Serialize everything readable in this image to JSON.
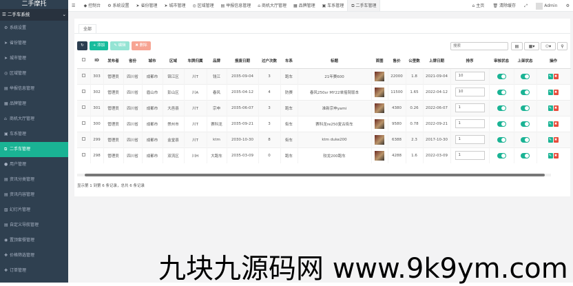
{
  "brand": "二手摩托",
  "sidebar": {
    "section_label": "二手车系统",
    "items": [
      {
        "icon": "⚙",
        "label": "系统设置",
        "active": false
      },
      {
        "icon": "➤",
        "label": "省份管理",
        "active": false
      },
      {
        "icon": "➤",
        "label": "城市管理",
        "active": false
      },
      {
        "icon": "◎",
        "label": "区域管理",
        "active": false
      },
      {
        "icon": "▤",
        "label": "举报信息管理",
        "active": false
      },
      {
        "icon": "▦",
        "label": "品牌管理",
        "active": false
      },
      {
        "icon": "⌂",
        "label": "商机大厅管理",
        "active": false
      },
      {
        "icon": "▣",
        "label": "车系管理",
        "active": false
      },
      {
        "icon": "⧉",
        "label": "二手车管理",
        "active": true
      },
      {
        "icon": "●",
        "label": "用户管理",
        "active": false
      },
      {
        "icon": "▤",
        "label": "资讯分类管理",
        "active": false
      },
      {
        "icon": "▤",
        "label": "资讯内容管理",
        "active": false
      },
      {
        "icon": "▧",
        "label": "幻灯片管理",
        "active": false
      },
      {
        "icon": "▤",
        "label": "自定义导航管理",
        "active": false
      },
      {
        "icon": "◉",
        "label": "置顶套餐管理",
        "active": false
      },
      {
        "icon": "✚",
        "label": "价格筛选管理",
        "active": false
      },
      {
        "icon": "✚",
        "label": "订单管理",
        "active": false
      }
    ]
  },
  "topbar": {
    "tabs": [
      {
        "icon": "◆",
        "label": "控制台",
        "active": false
      },
      {
        "icon": "⚙",
        "label": "系统设置",
        "active": false
      },
      {
        "icon": "➤",
        "label": "省份管理",
        "active": false
      },
      {
        "icon": "➤",
        "label": "城市管理",
        "active": false
      },
      {
        "icon": "◎",
        "label": "区域管理",
        "active": false
      },
      {
        "icon": "▤",
        "label": "举报信息管理",
        "active": false
      },
      {
        "icon": "⌂",
        "label": "商机大厅管理",
        "active": false
      },
      {
        "icon": "▦",
        "label": "品牌管理",
        "active": false
      },
      {
        "icon": "▣",
        "label": "车系管理",
        "active": false
      },
      {
        "icon": "⧉",
        "label": "二手车管理",
        "active": true
      }
    ],
    "home": "主页",
    "clear_cache": "清除缓存",
    "admin": "Admin"
  },
  "tab_all": "全部",
  "toolbar": {
    "refresh": "↻",
    "add": "+ 添加",
    "edit": "✎ 编辑",
    "delete": "✖ 删除",
    "search_placeholder": "搜索",
    "tool1": "▤",
    "tool2": "▦▾",
    "tool3": "⚇▾",
    "tool4": "⚲"
  },
  "colors": {
    "sidebar": "#2f4050",
    "accent": "#1ab394",
    "add": "#18bc9c",
    "edit": "#95e4d4",
    "delete": "#f7a493",
    "refresh": "#2c3e50",
    "op_edit": "#1ab394",
    "op_delete": "#e74c3c"
  },
  "table": {
    "columns": [
      "",
      "ID",
      "发布者",
      "省份",
      "城市",
      "区域",
      "车牌归属",
      "品牌",
      "报废日期",
      "过户次数",
      "车系",
      "标题",
      "首图",
      "售价",
      "公里数",
      "上牌日期",
      "排序",
      "审核状态",
      "上架状态",
      "操作"
    ],
    "rows": [
      [
        "303",
        "管理员",
        "四川省",
        "成都市",
        "锦江区",
        "川T",
        "钱江",
        "2035-09-04",
        "3",
        "跑车",
        "21年赛600",
        "",
        "22000",
        "1.8",
        "2021-09-04",
        "10",
        "",
        "",
        ""
      ],
      [
        "302",
        "管理员",
        "四川省",
        "眉山市",
        "彭山区",
        "川A",
        "春风",
        "2035-04-12",
        "4",
        "防赛",
        "春风250sr MY22单摇臂版本",
        "",
        "11500",
        "1.65",
        "2022-04-12",
        "10",
        "",
        "",
        ""
      ],
      [
        "301",
        "管理员",
        "四川省",
        "成都市",
        "大邑县",
        "川T",
        "宗申",
        "2035-06-07",
        "3",
        "跑车",
        "准新宗申yami",
        "",
        "4380",
        "0.26",
        "2022-06-07",
        "1",
        "",
        "",
        ""
      ],
      [
        "300",
        "管理员",
        "四川省",
        "成都市",
        "崇州市",
        "川T",
        "赛科龙",
        "2035-09-21",
        "3",
        "街车",
        "赛科龙re250复古街车",
        "",
        "9580",
        "0.78",
        "2022-09-21",
        "1",
        "",
        "",
        ""
      ],
      [
        "299",
        "管理员",
        "四川省",
        "成都市",
        "金堂县",
        "川T",
        "ktm",
        "2030-10-30",
        "8",
        "街车",
        "ktm duke200",
        "",
        "6388",
        "2.3",
        "2017-10-30",
        "1",
        "",
        "",
        ""
      ],
      [
        "298",
        "管理员",
        "四川省",
        "成都市",
        "双流区",
        "川H",
        "大跑车",
        "2035-03-09",
        "0",
        "跑车",
        "较龙200跑车",
        "",
        "4288",
        "1.6",
        "2022-03-09",
        "1",
        "",
        "",
        ""
      ]
    ]
  },
  "pagination": "显示第 1 到第 6 条记录，总共 6 条记录",
  "watermark": "九块九源码网 www.9k9ym.com"
}
